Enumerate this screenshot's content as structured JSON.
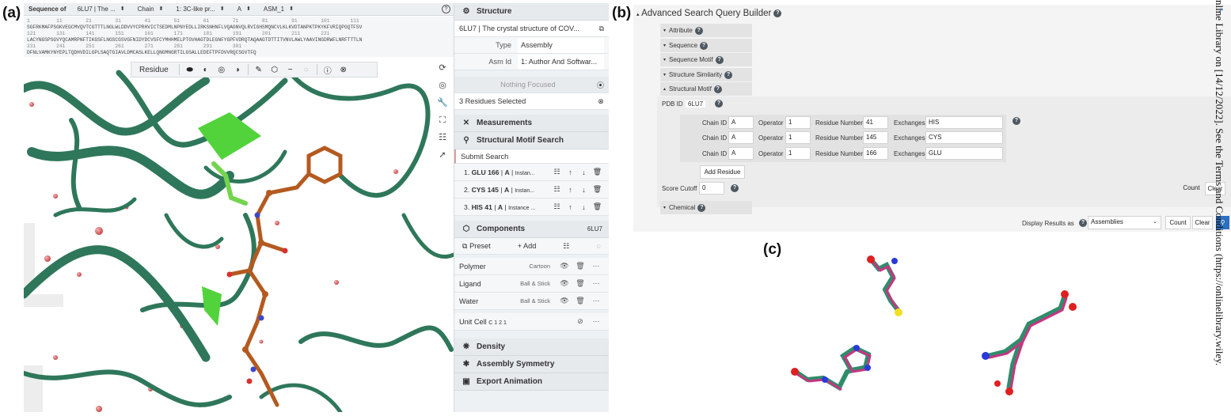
{
  "labels": {
    "a": "(a)",
    "b": "(b)",
    "c": "(c)"
  },
  "sequence": {
    "title": "Sequence of",
    "selectors": [
      "6LU7 | The ...",
      "Chain",
      "1: 3C-like pr...",
      "A",
      "ASM_1"
    ],
    "numbers_line1": "1         11        21        31        41        51        61        71        81        91        101       111",
    "line1": "SGFRKMAFPSGKVEGCMVQVTCGTTTLNGLWLDDVVYCPRHVICTSEDMLNPNYEDLLIRKSNHNFLVQAGNVQLRVIGHSMQNCVLKLKVDTANPKTPKYKFVRIQPGQTFSV",
    "numbers_line2": "121       131       141       151       161       171       181       191       201       211       221",
    "line2": "LACYNGSPSGVYQCAMRPNFTIKGSFLNGSCGSVGFNIDYDCVSFCYMHHMELPTGVHAGTDLEGNFYGPFVDRQTAQAAGTDTTITVNVLAWLYAAVINGDRWFLNRFTTTLN",
    "numbers_line3": "231       241       251       261       271       281       291       301",
    "line3": "DFNLVAMKYNYEPLTQDHVDILGPLSAQTGIAVLDMCASLKELLQNGMNGRTILGSALLEDEFTPFDVVRQCSGVTFQ"
  },
  "toolbar": {
    "mode": "Residue"
  },
  "controls": {
    "structure_header": "Structure",
    "entry_title": "6LU7 | The crystal structure of COV...",
    "type_label": "Type",
    "type_value": "Assembly",
    "asm_label": "Asm Id",
    "asm_value": "1: Author And Softwar...",
    "focus_text": "Nothing Focused",
    "selected_text": "3 Residues Selected",
    "measurements_header": "Measurements",
    "motif_header": "Structural Motif Search",
    "submit_label": "Submit Search",
    "residues": [
      {
        "label_num": "1.",
        "label_res": "GLU 166",
        "label_chain": "A",
        "label_rest": "Instan..."
      },
      {
        "label_num": "2.",
        "label_res": "CYS 145",
        "label_chain": "A",
        "label_rest": "Instan..."
      },
      {
        "label_num": "3.",
        "label_res": "HIS 41",
        "label_chain": "A",
        "label_rest": "Instance ..."
      }
    ],
    "components_header": "Components",
    "components_id": "6LU7",
    "preset_label": "Preset",
    "add_label": "Add",
    "components": [
      {
        "name": "Polymer",
        "rep": "Cartoon"
      },
      {
        "name": "Ligand",
        "rep": "Ball & Stick"
      },
      {
        "name": "Water",
        "rep": "Ball & Stick"
      }
    ],
    "unitcell_label": "Unit Cell",
    "unitcell_group": "C 1 2 1",
    "density_header": "Density",
    "symmetry_header": "Assembly Symmetry",
    "export_header": "Export Animation"
  },
  "search": {
    "title": "Advanced Search Query Builder",
    "sections": [
      "Attribute",
      "Sequence",
      "Sequence Motif",
      "Structure Similarity",
      "Structural Motif",
      "Chemical"
    ],
    "pdb_label": "PDB ID",
    "pdb_value": "6LU7",
    "chain_label": "Chain ID",
    "operator_label": "Operator",
    "resnum_label": "Residue Number",
    "exchanges_label": "Exchanges",
    "rows": [
      {
        "chain": "A",
        "operator": "1",
        "resnum": "41",
        "exchanges": "HIS"
      },
      {
        "chain": "A",
        "operator": "1",
        "resnum": "145",
        "exchanges": "CYS"
      },
      {
        "chain": "A",
        "operator": "1",
        "resnum": "166",
        "exchanges": "GLU"
      }
    ],
    "add_residue": "Add Residue",
    "score_label": "Score Cutoff",
    "score_value": "0",
    "count": "Count",
    "clear": "Clear",
    "display_label": "Display Results as",
    "display_value": "Assemblies"
  },
  "citation": "nline Library on [14/12/2022]. See the Terms and Conditions (https://onlinelibrary.wiley."
}
